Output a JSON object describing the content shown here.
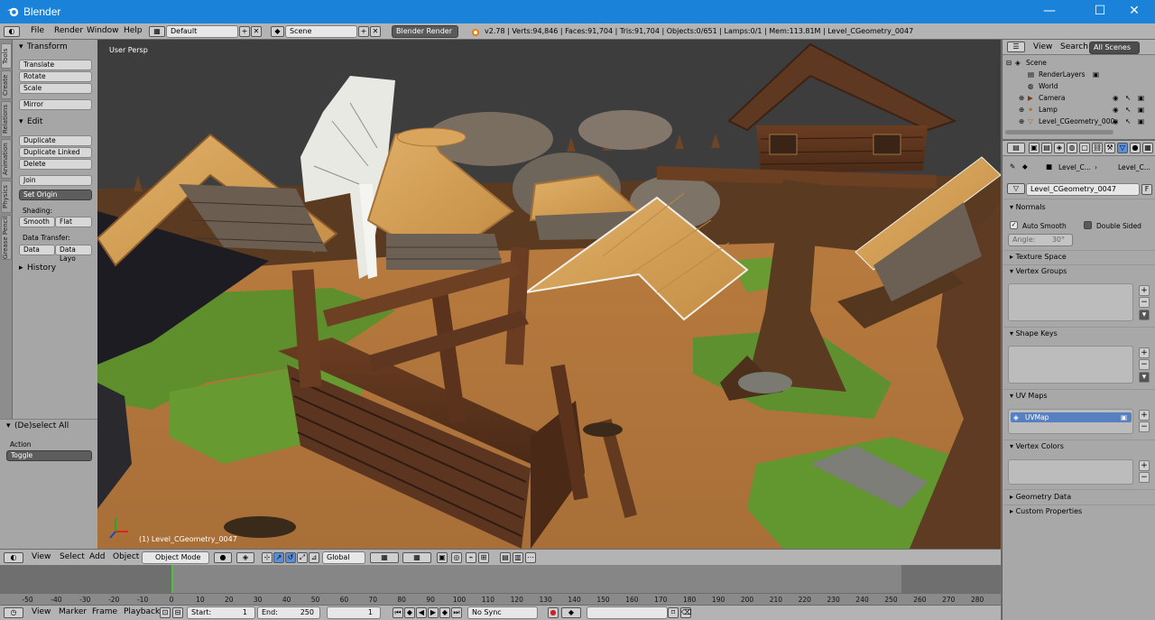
{
  "window": {
    "app_title": "Blender",
    "minimize": "—",
    "maximize": "☐",
    "close": "✕"
  },
  "info_header": {
    "menus": [
      "File",
      "Render",
      "Window",
      "Help"
    ],
    "screen_layout": "Default",
    "scene": "Scene",
    "render_engine": "Blender Render",
    "stats": "v2.78 | Verts:94,846 | Faces:91,704 | Tris:91,704 | Objects:0/651 | Lamps:0/1 | Mem:113.81M | Level_CGeometry_0047"
  },
  "left_tabs": [
    "Tools",
    "Create",
    "Relations",
    "Animation",
    "Physics",
    "Grease Pencil"
  ],
  "tool_shelf": {
    "transform_title": "Transform",
    "transform_buttons": [
      "Translate",
      "Rotate",
      "Scale",
      "Mirror"
    ],
    "edit_title": "Edit",
    "edit_buttons": [
      "Duplicate",
      "Duplicate Linked",
      "Delete",
      "Join"
    ],
    "set_origin": "Set Origin",
    "shading_label": "Shading:",
    "smooth": "Smooth",
    "flat": "Flat",
    "data_transfer_label": "Data Transfer:",
    "data": "Data",
    "data_layout": "Data Layo",
    "history": "History"
  },
  "operator_panel": {
    "title": "(De)select All",
    "action_label": "Action",
    "action_value": "Toggle"
  },
  "viewport": {
    "view_name": "User Persp",
    "object_info": "(1) Level_CGeometry_0047"
  },
  "viewport_header": {
    "menus": [
      "View",
      "Select",
      "Add",
      "Object"
    ],
    "mode": "Object Mode",
    "orientation": "Global"
  },
  "timeline": {
    "ticks": [
      "-50",
      "-40",
      "-30",
      "-20",
      "-10",
      "0",
      "10",
      "20",
      "30",
      "40",
      "50",
      "60",
      "70",
      "80",
      "90",
      "100",
      "110",
      "120",
      "130",
      "140",
      "150",
      "160",
      "170",
      "180",
      "190",
      "200",
      "210",
      "220",
      "230",
      "240",
      "250",
      "260",
      "270",
      "280"
    ],
    "current_frame": "1"
  },
  "timeline_header": {
    "menus": [
      "View",
      "Marker",
      "Frame",
      "Playback"
    ],
    "start": "Start:",
    "start_value": "1",
    "end": "End:",
    "end_value": "250",
    "frame_value": "1",
    "sync": "No Sync"
  },
  "outliner": {
    "view": "View",
    "search": "Search",
    "all_scenes": "All Scenes",
    "items": [
      "Scene",
      "RenderLayers",
      "World",
      "Camera",
      "Lamp",
      "Level_CGeometry_000"
    ]
  },
  "properties": {
    "breadcrumb_1": "Level_C...",
    "breadcrumb_2": "Level_C...",
    "mesh_name": "Level_CGeometry_0047",
    "fake_user": "F",
    "normals": "Normals",
    "auto_smooth": "Auto Smooth",
    "double_sided": "Double Sided",
    "angle": "Angle:",
    "angle_value": "30°",
    "texture_space": "Texture Space",
    "vertex_groups": "Vertex Groups",
    "shape_keys": "Shape Keys",
    "uv_maps": "UV Maps",
    "uv_map_item": "UVMap",
    "vertex_colors": "Vertex Colors",
    "geometry_data": "Geometry Data",
    "custom_properties": "Custom Properties"
  }
}
